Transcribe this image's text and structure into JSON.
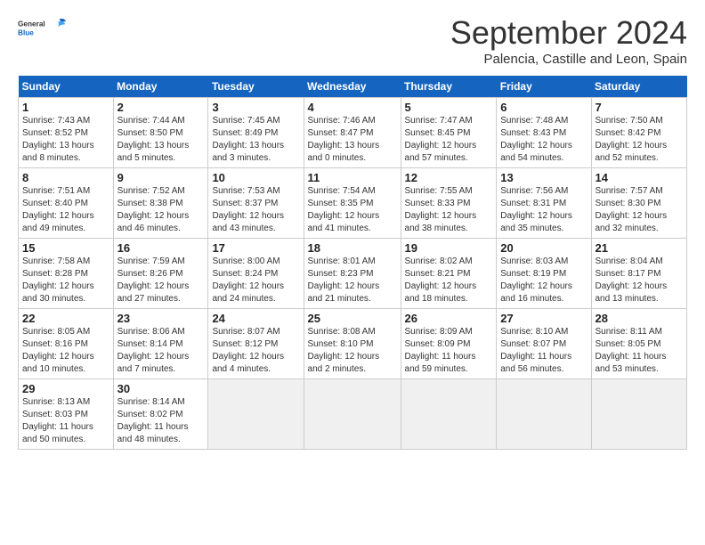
{
  "header": {
    "logo_line1": "General",
    "logo_line2": "Blue",
    "month_title": "September 2024",
    "subtitle": "Palencia, Castille and Leon, Spain"
  },
  "days_of_week": [
    "Sunday",
    "Monday",
    "Tuesday",
    "Wednesday",
    "Thursday",
    "Friday",
    "Saturday"
  ],
  "weeks": [
    [
      {
        "day": "1",
        "info": "Sunrise: 7:43 AM\nSunset: 8:52 PM\nDaylight: 13 hours\nand 8 minutes."
      },
      {
        "day": "2",
        "info": "Sunrise: 7:44 AM\nSunset: 8:50 PM\nDaylight: 13 hours\nand 5 minutes."
      },
      {
        "day": "3",
        "info": "Sunrise: 7:45 AM\nSunset: 8:49 PM\nDaylight: 13 hours\nand 3 minutes."
      },
      {
        "day": "4",
        "info": "Sunrise: 7:46 AM\nSunset: 8:47 PM\nDaylight: 13 hours\nand 0 minutes."
      },
      {
        "day": "5",
        "info": "Sunrise: 7:47 AM\nSunset: 8:45 PM\nDaylight: 12 hours\nand 57 minutes."
      },
      {
        "day": "6",
        "info": "Sunrise: 7:48 AM\nSunset: 8:43 PM\nDaylight: 12 hours\nand 54 minutes."
      },
      {
        "day": "7",
        "info": "Sunrise: 7:50 AM\nSunset: 8:42 PM\nDaylight: 12 hours\nand 52 minutes."
      }
    ],
    [
      {
        "day": "8",
        "info": "Sunrise: 7:51 AM\nSunset: 8:40 PM\nDaylight: 12 hours\nand 49 minutes."
      },
      {
        "day": "9",
        "info": "Sunrise: 7:52 AM\nSunset: 8:38 PM\nDaylight: 12 hours\nand 46 minutes."
      },
      {
        "day": "10",
        "info": "Sunrise: 7:53 AM\nSunset: 8:37 PM\nDaylight: 12 hours\nand 43 minutes."
      },
      {
        "day": "11",
        "info": "Sunrise: 7:54 AM\nSunset: 8:35 PM\nDaylight: 12 hours\nand 41 minutes."
      },
      {
        "day": "12",
        "info": "Sunrise: 7:55 AM\nSunset: 8:33 PM\nDaylight: 12 hours\nand 38 minutes."
      },
      {
        "day": "13",
        "info": "Sunrise: 7:56 AM\nSunset: 8:31 PM\nDaylight: 12 hours\nand 35 minutes."
      },
      {
        "day": "14",
        "info": "Sunrise: 7:57 AM\nSunset: 8:30 PM\nDaylight: 12 hours\nand 32 minutes."
      }
    ],
    [
      {
        "day": "15",
        "info": "Sunrise: 7:58 AM\nSunset: 8:28 PM\nDaylight: 12 hours\nand 30 minutes."
      },
      {
        "day": "16",
        "info": "Sunrise: 7:59 AM\nSunset: 8:26 PM\nDaylight: 12 hours\nand 27 minutes."
      },
      {
        "day": "17",
        "info": "Sunrise: 8:00 AM\nSunset: 8:24 PM\nDaylight: 12 hours\nand 24 minutes."
      },
      {
        "day": "18",
        "info": "Sunrise: 8:01 AM\nSunset: 8:23 PM\nDaylight: 12 hours\nand 21 minutes."
      },
      {
        "day": "19",
        "info": "Sunrise: 8:02 AM\nSunset: 8:21 PM\nDaylight: 12 hours\nand 18 minutes."
      },
      {
        "day": "20",
        "info": "Sunrise: 8:03 AM\nSunset: 8:19 PM\nDaylight: 12 hours\nand 16 minutes."
      },
      {
        "day": "21",
        "info": "Sunrise: 8:04 AM\nSunset: 8:17 PM\nDaylight: 12 hours\nand 13 minutes."
      }
    ],
    [
      {
        "day": "22",
        "info": "Sunrise: 8:05 AM\nSunset: 8:16 PM\nDaylight: 12 hours\nand 10 minutes."
      },
      {
        "day": "23",
        "info": "Sunrise: 8:06 AM\nSunset: 8:14 PM\nDaylight: 12 hours\nand 7 minutes."
      },
      {
        "day": "24",
        "info": "Sunrise: 8:07 AM\nSunset: 8:12 PM\nDaylight: 12 hours\nand 4 minutes."
      },
      {
        "day": "25",
        "info": "Sunrise: 8:08 AM\nSunset: 8:10 PM\nDaylight: 12 hours\nand 2 minutes."
      },
      {
        "day": "26",
        "info": "Sunrise: 8:09 AM\nSunset: 8:09 PM\nDaylight: 11 hours\nand 59 minutes."
      },
      {
        "day": "27",
        "info": "Sunrise: 8:10 AM\nSunset: 8:07 PM\nDaylight: 11 hours\nand 56 minutes."
      },
      {
        "day": "28",
        "info": "Sunrise: 8:11 AM\nSunset: 8:05 PM\nDaylight: 11 hours\nand 53 minutes."
      }
    ],
    [
      {
        "day": "29",
        "info": "Sunrise: 8:13 AM\nSunset: 8:03 PM\nDaylight: 11 hours\nand 50 minutes."
      },
      {
        "day": "30",
        "info": "Sunrise: 8:14 AM\nSunset: 8:02 PM\nDaylight: 11 hours\nand 48 minutes."
      },
      {
        "day": "",
        "info": ""
      },
      {
        "day": "",
        "info": ""
      },
      {
        "day": "",
        "info": ""
      },
      {
        "day": "",
        "info": ""
      },
      {
        "day": "",
        "info": ""
      }
    ]
  ]
}
